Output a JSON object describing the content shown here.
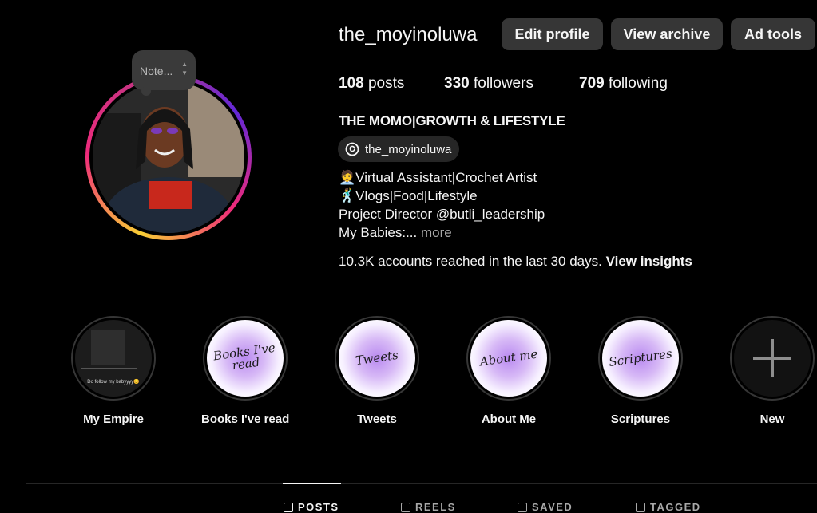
{
  "note": {
    "text": "Note..."
  },
  "profile": {
    "username": "the_moyinoluwa",
    "buttons": {
      "edit": "Edit profile",
      "archive": "View archive",
      "ad_tools": "Ad tools"
    },
    "stats": {
      "posts_count": "108",
      "posts_label": "posts",
      "followers_count": "330",
      "followers_label": "followers",
      "following_count": "709",
      "following_label": "following"
    },
    "full_name": "THE MOMO|GROWTH & LIFESTYLE",
    "threads_handle": "the_moyinoluwa",
    "bio": {
      "line1": "🧑‍💼Virtual Assistant|Crochet Artist",
      "line2": "🕺Vlogs|Food|Lifestyle",
      "line3": "Project Director @butli_leadership",
      "line4": "My Babies:...",
      "more": "more"
    },
    "reach": {
      "text": "10.3K accounts reached in the last 30 days.",
      "link": "View insights"
    }
  },
  "highlights": [
    {
      "label": "My Empire",
      "cover_text": "Do follow my babyyyy😊"
    },
    {
      "label": "Books I've read",
      "cover_text": "Books I've read"
    },
    {
      "label": "Tweets",
      "cover_text": "Tweets"
    },
    {
      "label": "About Me",
      "cover_text": "About me"
    },
    {
      "label": "Scriptures",
      "cover_text": "Scriptures"
    },
    {
      "label": "New"
    }
  ],
  "tabs": [
    {
      "label": "POSTS",
      "icon": "grid-icon"
    },
    {
      "label": "REELS",
      "icon": "reels-icon"
    },
    {
      "label": "SAVED",
      "icon": "bookmark-icon"
    },
    {
      "label": "TAGGED",
      "icon": "tagged-icon"
    }
  ],
  "colors": {
    "background": "#000000",
    "button": "#363636",
    "secondary_text": "#a8a8a8",
    "highlight_glow": "#b98af0"
  }
}
